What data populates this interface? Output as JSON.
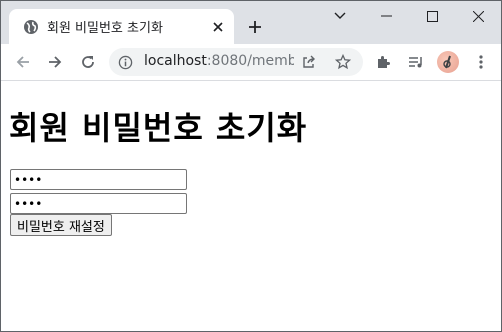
{
  "browser": {
    "tab": {
      "title": "회원 비밀번호 초기화",
      "favicon": "globe-icon"
    },
    "new_tab_icon": "plus-icon",
    "window_controls": [
      "chevron-down-icon",
      "minimize-icon",
      "maximize-icon",
      "close-icon"
    ],
    "toolbar": {
      "url_host": "localhost",
      "url_rest": ":8080/memb...",
      "icons": [
        "back-arrow-icon",
        "forward-arrow-icon",
        "reload-icon",
        "info-icon",
        "share-icon",
        "star-icon",
        "extensions-icon",
        "media-icon",
        "profile-avatar",
        "more-vert-icon"
      ]
    }
  },
  "page": {
    "heading": "회원 비밀번호 초기화",
    "password_1_value": "••••",
    "password_2_value": "••••",
    "submit_label": "비밀번호 재설정"
  },
  "colors": {
    "tabstrip_bg": "#dee1e6",
    "omnibox_bg": "#f1f3f4",
    "button_bg": "#efefef"
  }
}
